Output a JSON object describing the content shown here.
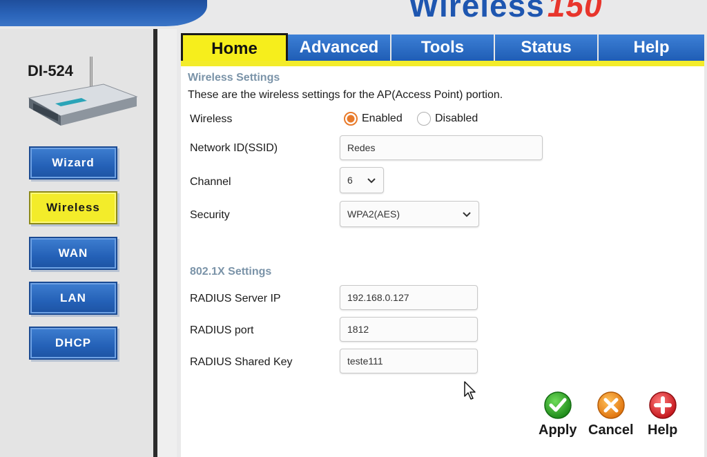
{
  "header": {
    "brand_word": "Wireless",
    "brand_speed": "150",
    "colors": {
      "brand_blue": "#1e56b0",
      "speed_red": "#e8352c",
      "accent_yellow": "#f3ec2a"
    }
  },
  "device": {
    "model": "DI-524",
    "image": "router-icon"
  },
  "sidebar": {
    "items": [
      {
        "label": "Wizard",
        "active": false
      },
      {
        "label": "Wireless",
        "active": true
      },
      {
        "label": "WAN",
        "active": false
      },
      {
        "label": "LAN",
        "active": false
      },
      {
        "label": "DHCP",
        "active": false
      }
    ]
  },
  "tabs": [
    {
      "label": "Home",
      "active": true
    },
    {
      "label": "Advanced",
      "active": false
    },
    {
      "label": "Tools",
      "active": false
    },
    {
      "label": "Status",
      "active": false
    },
    {
      "label": "Help",
      "active": false
    }
  ],
  "wireless_settings": {
    "title": "Wireless Settings",
    "description": "These are the wireless settings for the AP(Access Point) portion.",
    "wireless": {
      "label": "Wireless",
      "enabled_label": "Enabled",
      "disabled_label": "Disabled",
      "selected": "Enabled"
    },
    "ssid": {
      "label": "Network ID(SSID)",
      "value": "Redes"
    },
    "channel": {
      "label": "Channel",
      "value": "6"
    },
    "security": {
      "label": "Security",
      "value": "WPA2(AES)"
    }
  },
  "dot1x_settings": {
    "title": "802.1X Settings",
    "radius_ip": {
      "label": "RADIUS Server IP",
      "value": "192.168.0.127"
    },
    "radius_port": {
      "label": "RADIUS port",
      "value": "1812"
    },
    "radius_key": {
      "label": "RADIUS Shared Key",
      "value": "teste111"
    }
  },
  "actions": {
    "apply": "Apply",
    "cancel": "Cancel",
    "help": "Help"
  }
}
